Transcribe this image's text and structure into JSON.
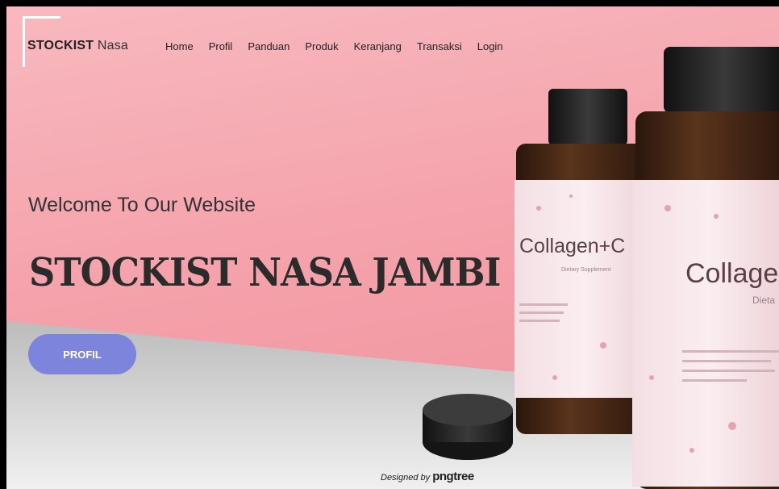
{
  "brand": {
    "bold": "STOCKIST",
    "rest": " Nasa"
  },
  "nav": {
    "items": [
      {
        "label": "Home"
      },
      {
        "label": "Profil"
      },
      {
        "label": "Panduan"
      },
      {
        "label": "Produk"
      },
      {
        "label": "Keranjang"
      },
      {
        "label": "Transaksi"
      },
      {
        "label": "Login"
      }
    ]
  },
  "hero": {
    "welcome": "Welcome To Our Website",
    "title": "STOCKIST NASA JAMBI",
    "button_label": "PROFIL"
  },
  "product": {
    "label_left": "Collagen+C",
    "label_right": "Collage",
    "sub_left": "Dietary Supplement",
    "sub_right": "Dieta"
  },
  "credit": {
    "prefix": "Designed by ",
    "brand": "pngtree"
  },
  "colors": {
    "background": "#f5a3ac",
    "button": "#7d84db",
    "floor": "#d9d9d9"
  }
}
